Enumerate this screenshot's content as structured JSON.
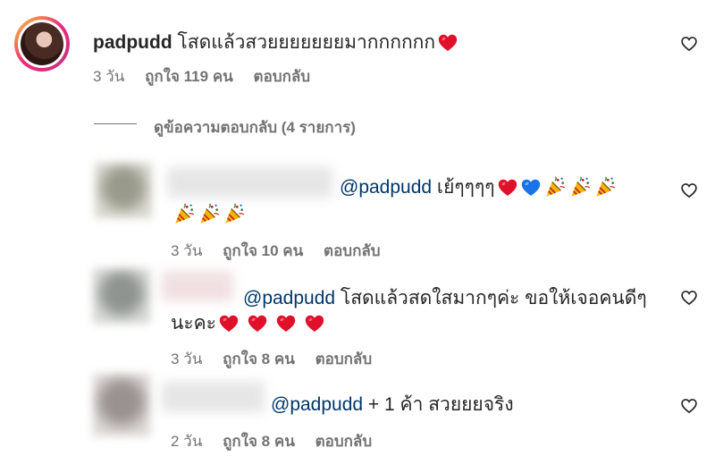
{
  "main_comment": {
    "username": "padpudd",
    "text": "โสดแล้วสวยยยยยยยมากกกกกก",
    "time": "3 วัน",
    "likes": "ถูกใจ 119 คน",
    "reply": "ตอบกลับ"
  },
  "view_replies": "ดูข้อความตอบกลับ (4 รายการ)",
  "replies": [
    {
      "mention": "@padpudd",
      "text": "เย้ๆๆๆๆ",
      "time": "3 วัน",
      "likes": "ถูกใจ 10 คน",
      "reply": "ตอบกลับ"
    },
    {
      "mention": "@padpudd",
      "text_line1": "โสดแล้วสดใสมากๆค่ะ ขอให้เจอคนดีๆ",
      "text_line2": "นะคะ",
      "time": "3 วัน",
      "likes": "ถูกใจ 8 คน",
      "reply": "ตอบกลับ"
    },
    {
      "mention": "@padpudd",
      "text": "+ 1 ค้า สวยยยจริง",
      "time": "2 วัน",
      "likes": "ถูกใจ 8 คน",
      "reply": "ตอบกลับ"
    }
  ],
  "icons": {
    "like": "heart-outline-icon",
    "red_heart": "red-heart-emoji",
    "blue_heart": "blue-heart-emoji",
    "party_popper": "party-popper-emoji"
  },
  "colors": {
    "mention": "#00376b",
    "meta": "#737373",
    "heart_red": "#e0102a",
    "heart_blue": "#1a73e8"
  }
}
